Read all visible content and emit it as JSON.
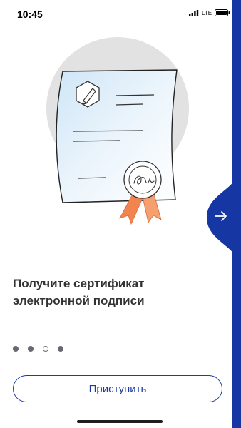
{
  "status_bar": {
    "time": "10:45",
    "network": "LTE"
  },
  "onboarding": {
    "title": "Получите сертификат электронной подписи",
    "page_total": 4,
    "page_current": 3,
    "next_icon": "arrow-right-icon",
    "start_label": "Приступить"
  },
  "colors": {
    "brand": "#1636a4",
    "text": "#333333",
    "ribbon": "#f28450",
    "circle": "#e2e2e2"
  }
}
